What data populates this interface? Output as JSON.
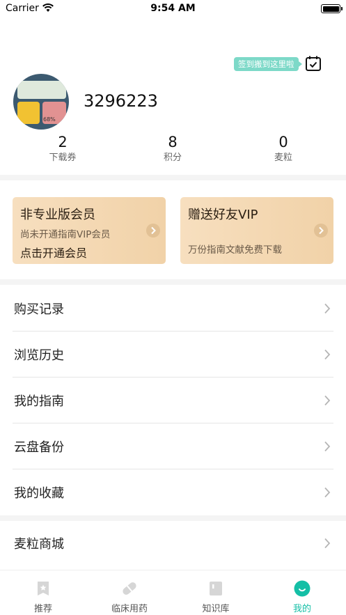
{
  "status_bar": {
    "carrier": "Carrier",
    "time": "9:54 AM"
  },
  "header": {
    "sign_tag": "签到搬到这里啦"
  },
  "profile": {
    "username": "3296223",
    "avatar_percent": "68%"
  },
  "stats": [
    {
      "value": "2",
      "label": "下载券"
    },
    {
      "value": "8",
      "label": "积分"
    },
    {
      "value": "0",
      "label": "麦粒"
    }
  ],
  "vip_cards": {
    "member": {
      "title": "非专业版会员",
      "subtitle": "尚未开通指南VIP会员",
      "action": "点击开通会员"
    },
    "gift": {
      "title": "赠送好友VIP",
      "subtitle": "万份指南文献免费下载"
    }
  },
  "menu": [
    {
      "label": "购买记录"
    },
    {
      "label": "浏览历史"
    },
    {
      "label": "我的指南"
    },
    {
      "label": "云盘备份"
    },
    {
      "label": "我的收藏"
    },
    {
      "label": "麦粒商城"
    }
  ],
  "tabbar": [
    {
      "label": "推荐",
      "icon": "star-bookmark-icon"
    },
    {
      "label": "临床用药",
      "icon": "pill-icon"
    },
    {
      "label": "知识库",
      "icon": "book-icon"
    },
    {
      "label": "我的",
      "icon": "profile-face-icon"
    }
  ],
  "colors": {
    "accent": "#14bfa6",
    "sign_tag": "#7dd9c8",
    "vip_card": "#f3d6b0",
    "separator": "#f4f4f4"
  }
}
